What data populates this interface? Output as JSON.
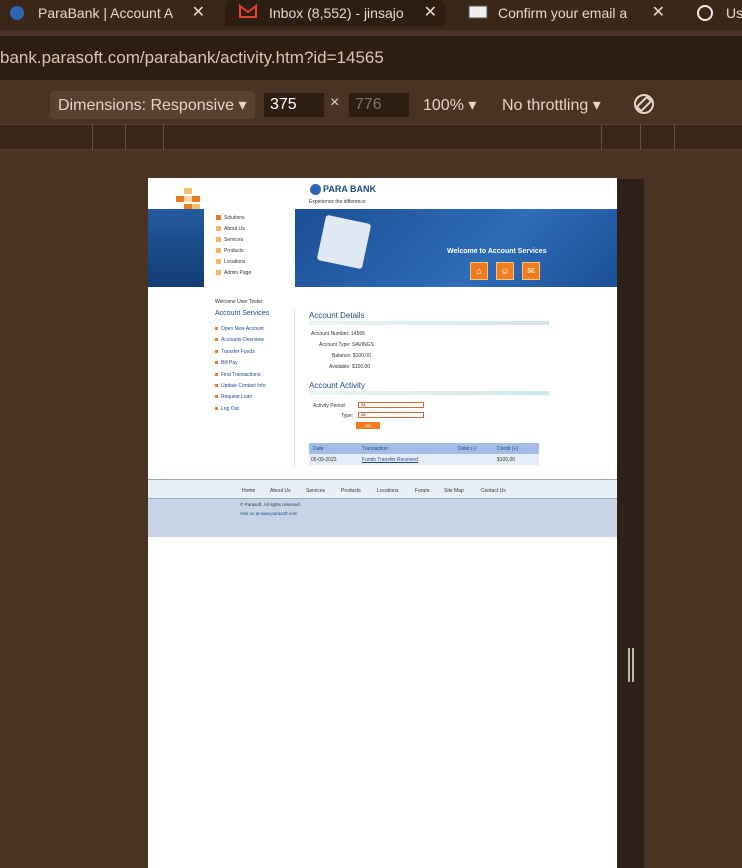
{
  "browser": {
    "tabs": [
      {
        "title": "ParaBank | Account A",
        "close": "✕",
        "icon": "parabank-icon"
      },
      {
        "title": "Inbox (8,552) - jinsajo",
        "close": "✕",
        "icon": "gmail-icon"
      },
      {
        "title": "Confirm your email a",
        "close": "✕",
        "icon": "mail-icon"
      },
      {
        "title": "Us",
        "icon": "openai-icon"
      }
    ],
    "address": "bank.parasoft.com/parabank/activity.htm?id=14565"
  },
  "devtools": {
    "dimensions_label": "Dimensions: Responsive",
    "width": "375",
    "times": "×",
    "height_placeholder": "776",
    "zoom": "100%",
    "throttling": "No throttling"
  },
  "page": {
    "brand": "PARA BANK",
    "caption": "Experience the difference",
    "menu": [
      "Solutions",
      "About Us",
      "Services",
      "Products",
      "Locations",
      "Admin Page"
    ],
    "banner_title": "Welcome to Account Services",
    "welcome": "Welcome User Tester",
    "services_title": "Account Services",
    "services": [
      "Open New Account",
      "Accounts Overview",
      "Transfer Funds",
      "Bill Pay",
      "Find Transactions",
      "Update Contact Info",
      "Request Loan",
      "Log Out"
    ],
    "details_title": "Account Details",
    "details": {
      "number_label": "Account Number:",
      "number": "14565",
      "type_label": "Account Type:",
      "type": "SAVINGS",
      "balance_label": "Balance:",
      "balance": "$100.00",
      "available_label": "Available:",
      "available": "$100.00"
    },
    "activity_title": "Account Activity",
    "period_label": "Activity Period:",
    "period_value": "All",
    "type_filter_label": "Type:",
    "type_filter_value": "All",
    "go_label": "GO",
    "table": {
      "headers": [
        "Date",
        "Transaction",
        "Debit (-)",
        "Credit (+)"
      ],
      "rows": [
        {
          "date": "05-09-2023",
          "transaction": "Funds Transfer Received",
          "debit": "",
          "credit": "$100.00"
        }
      ]
    },
    "footer_links": [
      "Home",
      "About Us",
      "Services",
      "Products",
      "Locations",
      "Forum",
      "Site Map",
      "Contact Us"
    ],
    "copyright": "© Parasoft. All rights reserved.",
    "visit": "Visit us at www.parasoft.com"
  }
}
